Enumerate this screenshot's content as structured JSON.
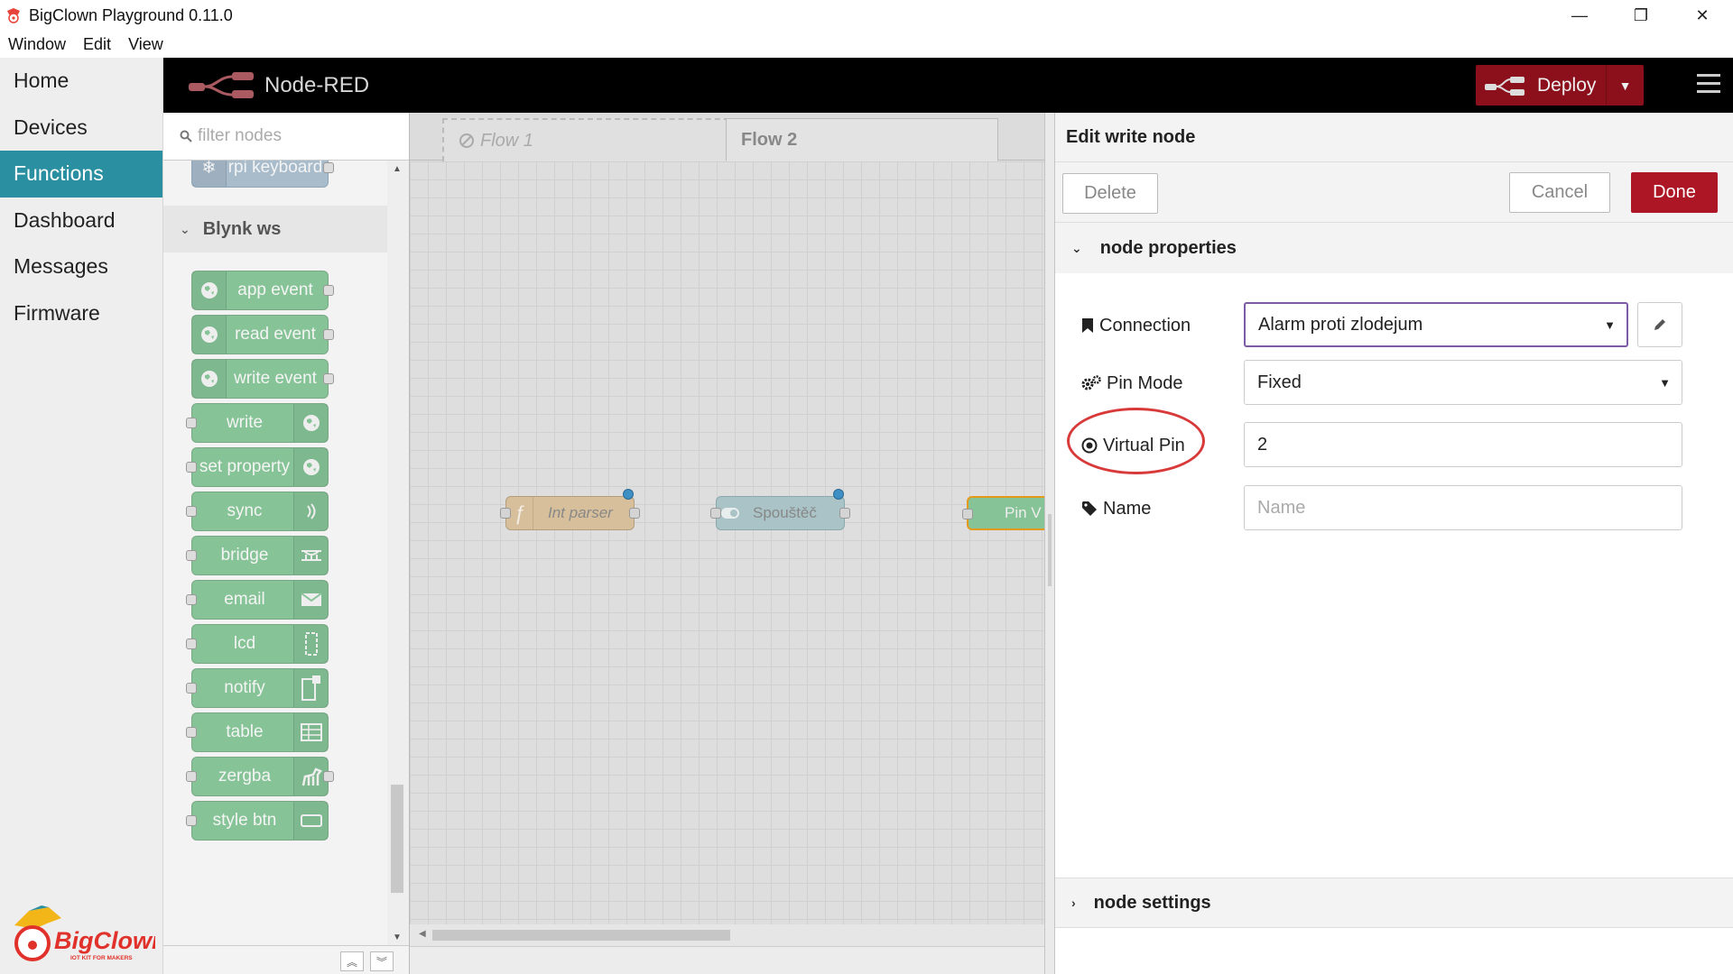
{
  "window": {
    "title": "BigClown Playground 0.11.0",
    "controls": [
      "—",
      "❐",
      "✕"
    ],
    "menu": [
      "Window",
      "Edit",
      "View"
    ]
  },
  "appnav": {
    "items": [
      {
        "label": "Home"
      },
      {
        "label": "Devices"
      },
      {
        "label": "Functions"
      },
      {
        "label": "Dashboard"
      },
      {
        "label": "Messages"
      },
      {
        "label": "Firmware"
      }
    ],
    "active": "Functions",
    "logo_text": "BigClown",
    "logo_tagline": "IOT KIT FOR MAKERS"
  },
  "header": {
    "title": "Node-RED",
    "deploy_label": "Deploy",
    "deploy_color": "#8c101c"
  },
  "palette": {
    "filter_placeholder": "filter nodes",
    "partial_node": "rpi keyboard",
    "category": "Blynk ws",
    "nodes": [
      {
        "label": "app event",
        "icon": "globe-icon"
      },
      {
        "label": "read event",
        "icon": "globe-icon"
      },
      {
        "label": "write event",
        "icon": "globe-icon"
      },
      {
        "label": "write",
        "icon": "globe-icon"
      },
      {
        "label": "set property",
        "icon": "globe-icon"
      },
      {
        "label": "sync",
        "icon": "wifi-icon"
      },
      {
        "label": "bridge",
        "icon": "bridge-icon"
      },
      {
        "label": "email",
        "icon": "envelope-icon"
      },
      {
        "label": "lcd",
        "icon": "lcd-icon"
      },
      {
        "label": "notify",
        "icon": "phone-icon"
      },
      {
        "label": "table",
        "icon": "table-icon"
      },
      {
        "label": "zergba",
        "icon": "zebra-icon"
      },
      {
        "label": "style btn",
        "icon": "button-icon"
      }
    ],
    "node_color": "#86c497"
  },
  "workspace": {
    "tabs": [
      {
        "label": "Flow 1",
        "disabled": true
      },
      {
        "label": "Flow 2",
        "active": true
      }
    ],
    "flow_nodes": [
      {
        "label": "Int parser",
        "icon": "function-icon"
      },
      {
        "label": "Spouštěč",
        "icon": "toggle-icon"
      },
      {
        "label": "Pin V"
      }
    ]
  },
  "tray": {
    "title": "Edit write node",
    "delete_label": "Delete",
    "cancel_label": "Cancel",
    "done_label": "Done",
    "done_color": "#ad1625",
    "properties_label": "node properties",
    "settings_label": "node settings",
    "fields": {
      "connection": {
        "label": "Connection",
        "value": "Alarm proti zlodejum"
      },
      "pin_mode": {
        "label": "Pin Mode",
        "value": "Fixed"
      },
      "virtual_pin": {
        "label": "Virtual Pin",
        "value": "2"
      },
      "name": {
        "label": "Name",
        "value": "",
        "placeholder": "Name"
      }
    }
  }
}
